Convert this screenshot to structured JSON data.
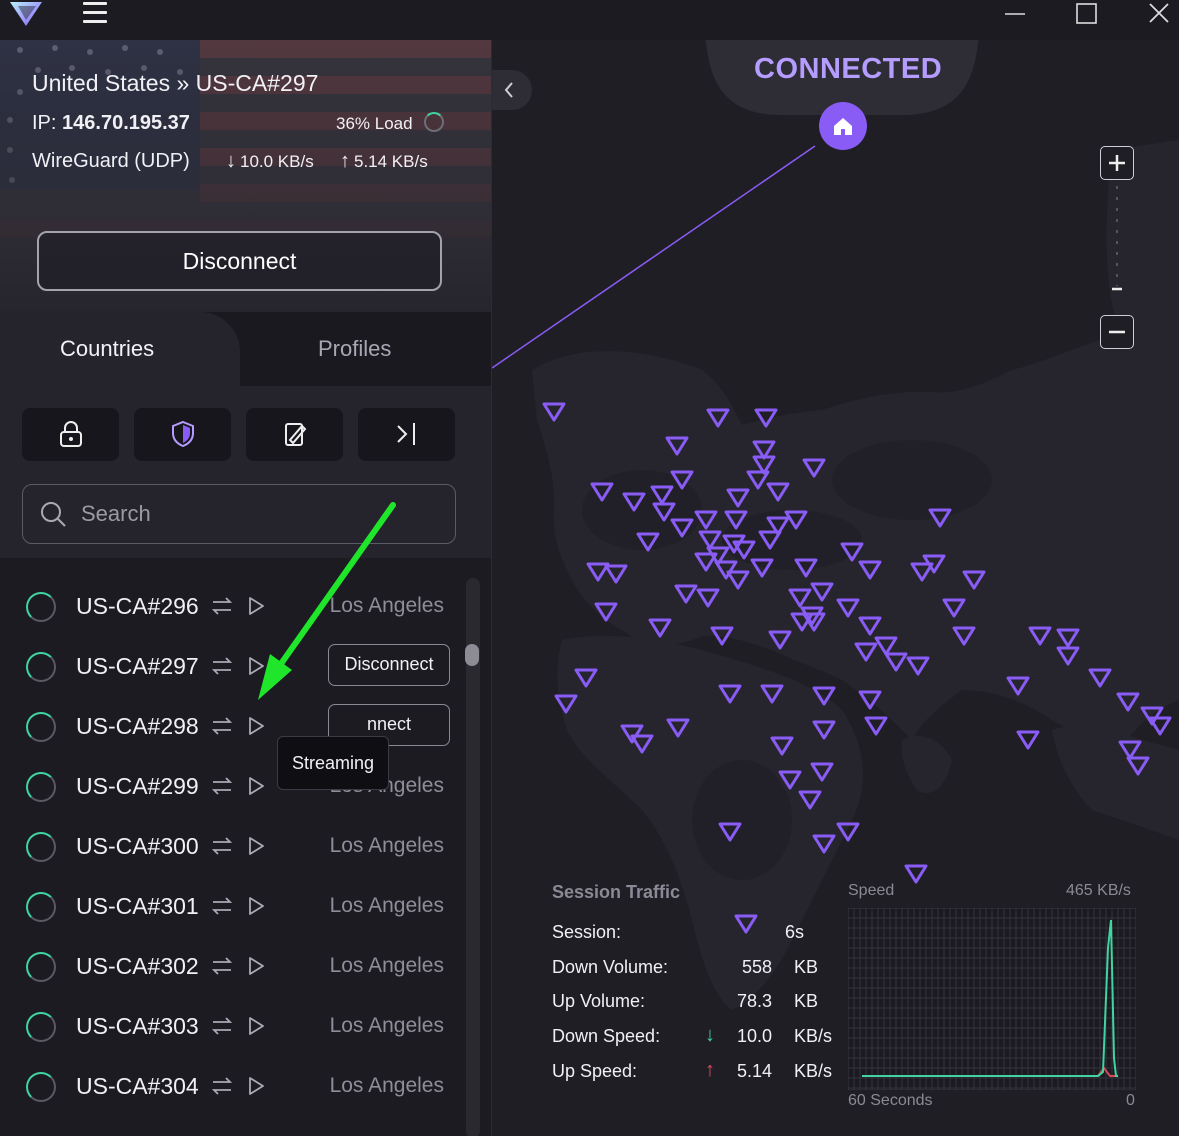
{
  "titlebar": {
    "window_controls": [
      "minimize-icon",
      "maximize-icon",
      "close-icon"
    ]
  },
  "connection": {
    "country": "United States",
    "separator": "»",
    "server": "US-CA#297",
    "ip_label": "IP:",
    "ip": "146.70.195.37",
    "load": "36% Load",
    "protocol": "WireGuard (UDP)",
    "download_speed": "10.0 KB/s",
    "upload_speed": "5.14 KB/s",
    "disconnect_label": "Disconnect"
  },
  "tabs": {
    "countries": "Countries",
    "profiles": "Profiles"
  },
  "filters": [
    "lock-icon",
    "shield-icon",
    "edit-icon",
    "collapse-icon"
  ],
  "search": {
    "placeholder": "Search"
  },
  "servers": [
    {
      "name": "US-CA#296",
      "city": "Los Angeles"
    },
    {
      "name": "US-CA#297",
      "city": "",
      "button": "Disconnect"
    },
    {
      "name": "US-CA#298",
      "city": "",
      "button": "nnect"
    },
    {
      "name": "US-CA#299",
      "city": "Los Angeles"
    },
    {
      "name": "US-CA#300",
      "city": "Los Angeles"
    },
    {
      "name": "US-CA#301",
      "city": "Los Angeles"
    },
    {
      "name": "US-CA#302",
      "city": "Los Angeles"
    },
    {
      "name": "US-CA#303",
      "city": "Los Angeles"
    },
    {
      "name": "US-CA#304",
      "city": "Los Angeles"
    }
  ],
  "tooltip": "Streaming",
  "map": {
    "status": "CONNECTED",
    "accent_color": "#8a5cf6"
  },
  "session_traffic": {
    "title": "Session Traffic",
    "session_label": "Session:",
    "session_value": "6s",
    "down_volume_label": "Down Volume:",
    "down_volume_value": "558",
    "down_volume_unit": "KB",
    "up_volume_label": "Up Volume:",
    "up_volume_value": "78.3",
    "up_volume_unit": "KB",
    "down_speed_label": "Down Speed:",
    "down_speed_value": "10.0",
    "down_speed_unit": "KB/s",
    "up_speed_label": "Up Speed:",
    "up_speed_value": "5.14",
    "up_speed_unit": "KB/s"
  },
  "speed_graph": {
    "label": "Speed",
    "max": "465  KB/s",
    "x_left": "60 Seconds",
    "x_right": "0"
  }
}
